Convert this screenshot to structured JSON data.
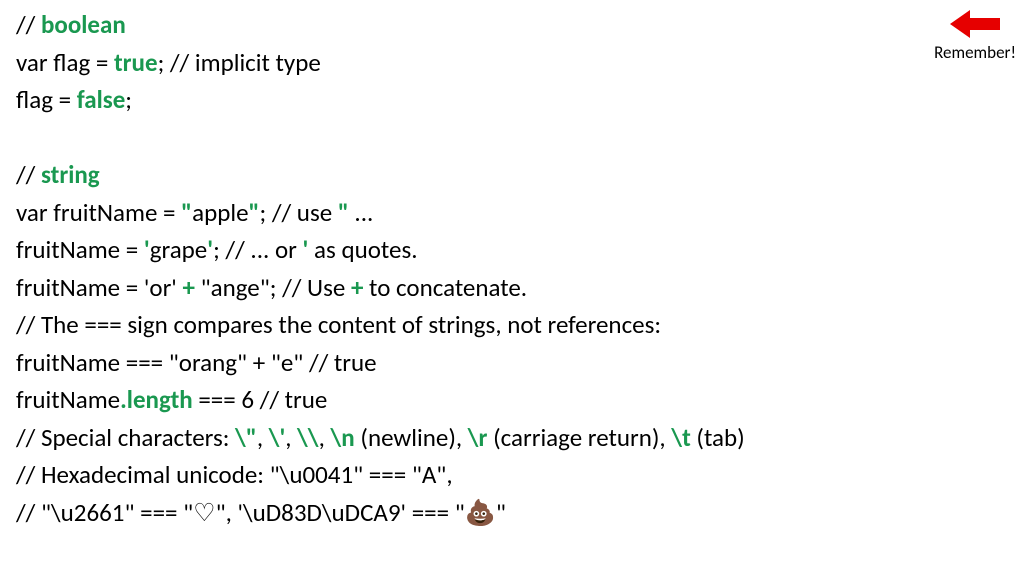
{
  "remember": {
    "label": "Remember!"
  },
  "lines": {
    "l1": {
      "a": "// ",
      "b": "boolean"
    },
    "l2": {
      "a": "var flag = ",
      "b": "true",
      "c": ";   // implicit type"
    },
    "l3": {
      "a": "flag = ",
      "b": "false",
      "c": ";"
    },
    "l4": {
      "a": "// ",
      "b": "string"
    },
    "l5": {
      "a": "var fruitName = ",
      "b": "\"",
      "c": "apple",
      "d": "\"",
      "e": "; // use ",
      "f": "\"",
      "g": " ..."
    },
    "l6": {
      "a": "fruitName = ",
      "b": "'",
      "c": "grape",
      "d": "'",
      "e": "; // ... or ",
      "f": "'",
      "g": " as quotes."
    },
    "l7": {
      "a": "fruitName = 'or' ",
      "b": "+",
      "c": " \"ange\";  // Use ",
      "d": "+",
      "e": " to concatenate."
    },
    "l8": {
      "a": "// The === sign compares the content of strings, not references:"
    },
    "l9": {
      "a": "fruitName === \"orang\" + \"e\"   // true"
    },
    "l10": {
      "a": "fruitName",
      "b": ".length",
      "c": " === 6   // true"
    },
    "l11": {
      "a": "// Special characters: ",
      "b": "\\\"",
      "c": ", ",
      "d": "\\'",
      "e": ", ",
      "f": "\\\\",
      "g": ", ",
      "h": "\\n",
      "i": " (newline), ",
      "j": "\\r",
      "k": " (carriage return), ",
      "l": "\\t",
      "m": " (tab)"
    },
    "l12": {
      "a": "// Hexadecimal unicode: \"\\u0041\" === \"A\","
    },
    "l13": {
      "a": "//    \"\\u2661\" === \"♡\", '\\uD83D\\uDCA9' === \"",
      "b": "💩",
      "c": "\""
    }
  }
}
